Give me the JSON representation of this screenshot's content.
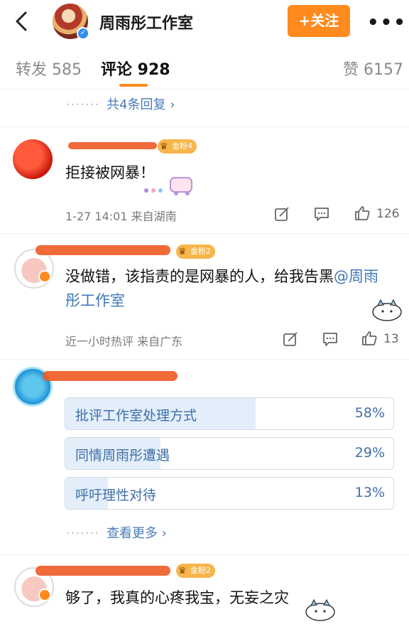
{
  "header": {
    "back_icon": "chevron-left-icon",
    "account_name": "周雨彤工作室",
    "follow_label": "+关注",
    "more_icon": "ellipsis-icon"
  },
  "tabs": [
    {
      "label": "转发 585"
    },
    {
      "label": "评论 928"
    },
    {
      "label": "赞 6157"
    }
  ],
  "reply_link": "共4条回复",
  "comments": [
    {
      "badge": "金粉4",
      "text": "拒接被网暴！",
      "meta": "1-27 14:01 来自湖南",
      "likes": "126"
    },
    {
      "badge": "金粉2",
      "text_prefix": "没做错，该指责的是网暴的人，给我告黑",
      "mention": "@周雨彤工作室",
      "meta": "近一小时热评 来自广东",
      "likes": "13"
    },
    {
      "poll": [
        {
          "label": "批评工作室处理方式",
          "percent": "58%",
          "value": 58
        },
        {
          "label": "同情周雨彤遭遇",
          "percent": "29%",
          "value": 29
        },
        {
          "label": "呼吁理性对待",
          "percent": "13%",
          "value": 13
        }
      ],
      "more_label": "查看更多"
    },
    {
      "badge": "金粉2",
      "text": "够了，我真的心疼我宝，无妄之灾"
    }
  ],
  "colors": {
    "accent": "#ff8a1e",
    "link": "#4a7bb8"
  }
}
